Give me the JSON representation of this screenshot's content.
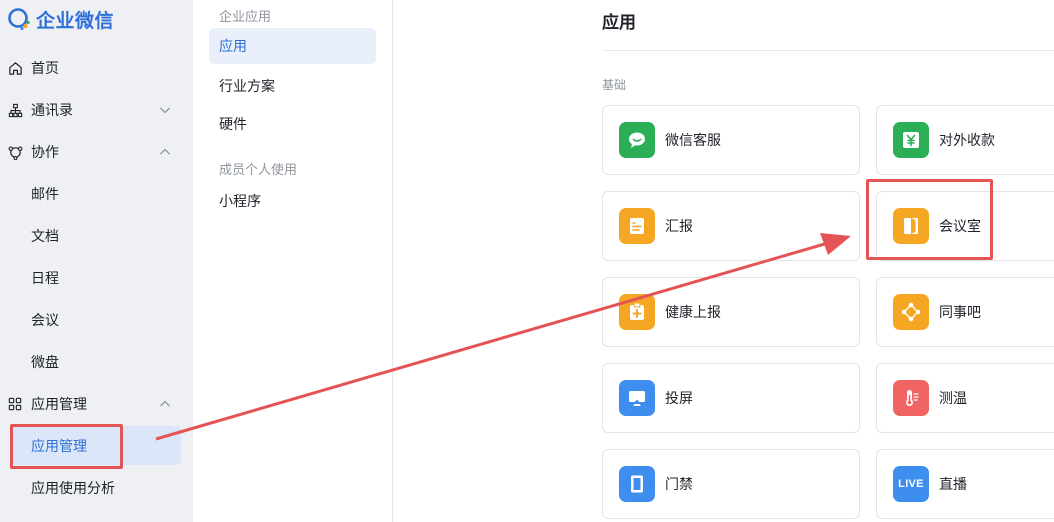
{
  "brand": {
    "name": "企业微信"
  },
  "sidebar": {
    "items": [
      {
        "label": "首页",
        "icon": "home-icon"
      },
      {
        "label": "通讯录",
        "icon": "org-chart-icon"
      },
      {
        "label": "协作",
        "icon": "collaboration-icon"
      },
      {
        "label": "应用管理",
        "icon": "grid-icon"
      }
    ],
    "collab_sub": [
      "邮件",
      "文档",
      "日程",
      "会议",
      "微盘"
    ],
    "app_sub": [
      "应用管理",
      "应用使用分析"
    ]
  },
  "midcol": {
    "group1": "企业应用",
    "items1": [
      "应用",
      "行业方案",
      "硬件"
    ],
    "group2": "成员个人使用",
    "items2": [
      "小程序"
    ]
  },
  "main": {
    "title": "应用",
    "section": "基础",
    "apps": [
      {
        "name": "微信客服",
        "icon": "wechat-service-icon",
        "color": "#2bae56"
      },
      {
        "name": "对外收款",
        "icon": "yuan-payment-icon",
        "color": "#2bae56"
      },
      {
        "name": "汇报",
        "icon": "report-icon",
        "color": "#f5a623"
      },
      {
        "name": "会议室",
        "icon": "door-icon",
        "color": "#f5a623"
      },
      {
        "name": "健康上报",
        "icon": "health-report-icon",
        "color": "#f5a623"
      },
      {
        "name": "同事吧",
        "icon": "network-icon",
        "color": "#f5a623"
      },
      {
        "name": "投屏",
        "icon": "screen-cast-icon",
        "color": "#3e8ef0"
      },
      {
        "name": "测温",
        "icon": "thermometer-icon",
        "color": "#f06464"
      },
      {
        "name": "门禁",
        "icon": "access-door-icon",
        "color": "#3e8ef0"
      },
      {
        "name": "直播",
        "icon": "live-icon",
        "color": "#3e8ef0",
        "badge": "LIVE"
      }
    ]
  },
  "colors": {
    "accent": "#2f6fd8",
    "annotation": "#e45454"
  }
}
